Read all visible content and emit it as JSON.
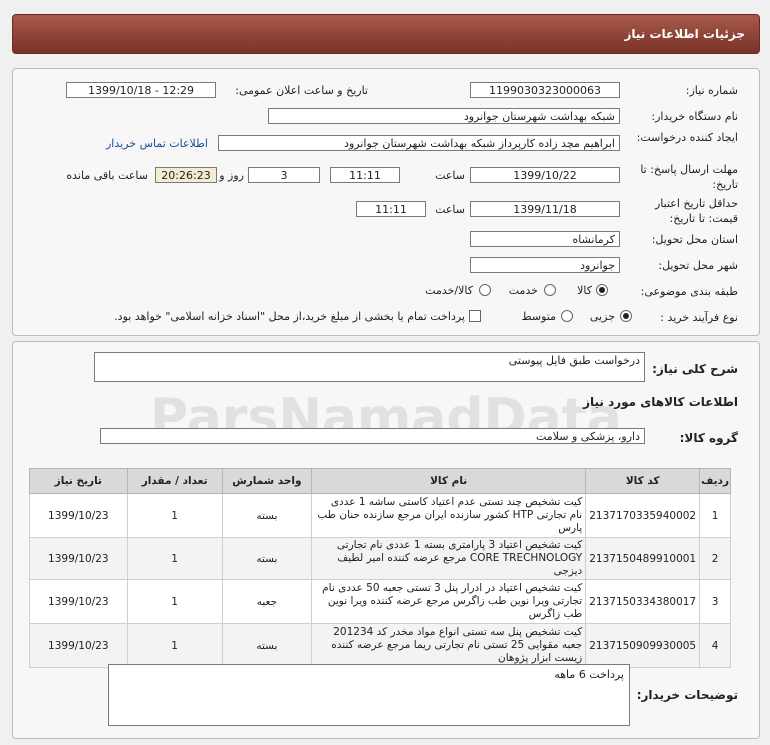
{
  "header": {
    "title": "جزئیات اطلاعات نیاز"
  },
  "details": {
    "need_number_label": "شماره نیاز:",
    "need_number": "1199030323000063",
    "announce_label": "تاریخ و ساعت اعلان عمومی:",
    "announce_value": "1399/10/18 - 12:29",
    "buyer_org_label": "نام دستگاه خریدار:",
    "buyer_org": "شبکه بهداشت شهرستان جوانرود",
    "creator_label": "ایجاد کننده درخواست:",
    "creator": "ابراهیم مچد زاده کارپرداز شبکه بهداشت شهرستان جوانرود",
    "contact_link": "اطلاعات تماس خریدار",
    "deadline_label": "مهلت ارسال پاسخ: تا تاریخ:",
    "deadline_date": "1399/10/22",
    "time_label": "ساعت",
    "deadline_time": "11:11",
    "days_value": "3",
    "days_label": "روز و",
    "remaining_time": "20:26:23",
    "remaining_label": "ساعت باقی مانده",
    "validity_label": "حداقل تاریخ اعتبار قیمت: تا تاریخ:",
    "validity_date": "1399/11/18",
    "validity_time": "11:11",
    "province_label": "استان محل تحویل:",
    "province": "کرمانشاه",
    "city_label": "شهر محل تحویل:",
    "city": "جوانرود",
    "category_label": "طبقه بندی موضوعی:",
    "cat_goods": "کالا",
    "cat_service": "خدمت",
    "cat_both": "کالا/خدمت",
    "process_label": "نوع فرآیند خرید :",
    "proc_partial": "جزیی",
    "proc_medium": "متوسط",
    "payment_note": "پرداخت تمام یا بخشی از مبلغ خرید،از محل \"اسناد خزانه اسلامی\" خواهد بود."
  },
  "summary": {
    "label": "شرح کلی نیاز:",
    "value": "درخواست طبق فایل پیوستی",
    "goods_info_title": "اطلاعات کالاهای مورد نیاز",
    "group_label": "گروه کالا:",
    "group_value": "دارو، پزشکی و سلامت"
  },
  "table": {
    "headers": [
      "ردیف",
      "کد کالا",
      "نام کالا",
      "واحد شمارش",
      "تعداد / مقدار",
      "تاریخ نیاز"
    ],
    "rows": [
      [
        "1",
        "2137170335940002",
        "کیت تشخیص چند تستی عدم اعتیاد کاستی ساشه 1 عددی نام تجارتی HTP کشور سازنده ایران مرجع سازنده حنان طب پارس",
        "بسته",
        "1",
        "1399/10/23"
      ],
      [
        "2",
        "2137150489910001",
        "کیت تشخیص اعتیاد 3 پارامتری بسته 1 عددی نام تجارتی CORE TRECHNOLOGY مرجع عرضه کننده امیر لطیف دیزجی",
        "بسته",
        "1",
        "1399/10/23"
      ],
      [
        "3",
        "2137150334380017",
        "کیت تشخیص اعتیاد در ادرار پنل 3 تستی جعبه 50 عددی نام تجارتی ویرا نوین طب زاگرس مرجع عرضه کننده ویرا نوین طب زاگرس",
        "جعبه",
        "1",
        "1399/10/23"
      ],
      [
        "4",
        "2137150909930005",
        "کیت تشخیص پنل سه تستی انواع مواد مخدر کد 201234 جعبه مقوایی 25 تستی نام تجارتی ریما مرجع عرضه کننده زیست ابزار پژوهان",
        "بسته",
        "1",
        "1399/10/23"
      ]
    ]
  },
  "buyer_notes": {
    "label": "توضیحات خریدار:",
    "value": "پرداخت 6 ماهه"
  },
  "watermark": "ParsNamadData"
}
